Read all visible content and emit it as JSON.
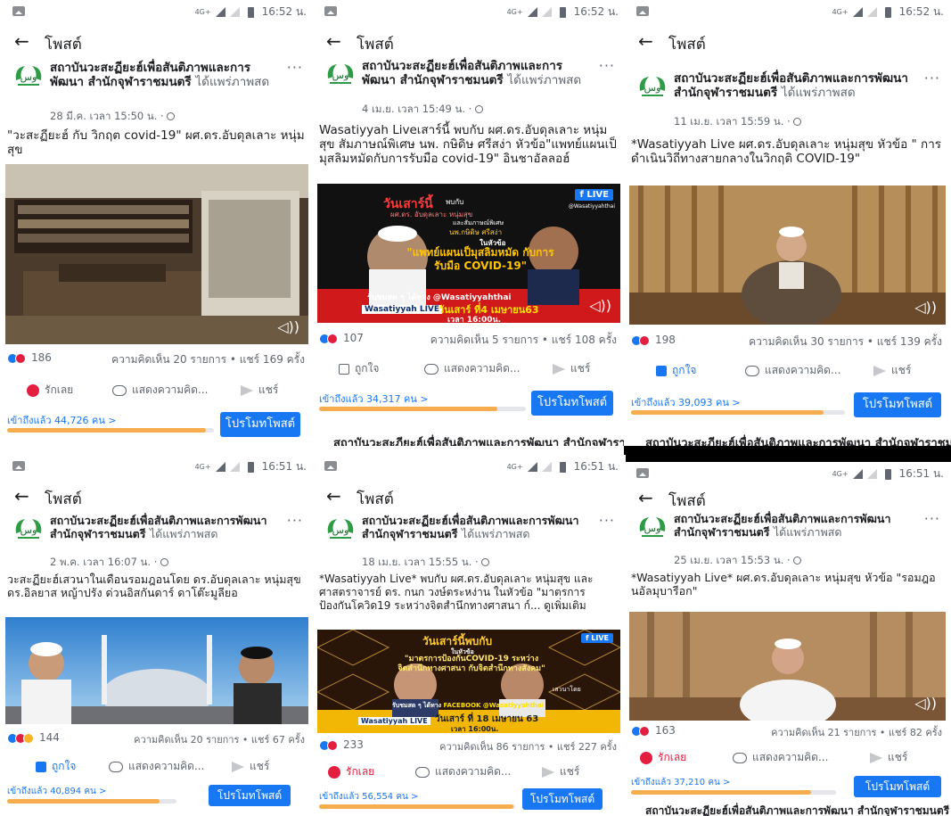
{
  "common": {
    "back_glyph": "←",
    "header_title": "โพสต์",
    "network": "4G+",
    "page_name": "สถาบันวะสะฏียะฮ์เพื่อสันติภาพและการพัฒนา สำนักจุฬาราชมนตรี",
    "shared_suffix": "ได้แพร่ภาพสด",
    "more_glyph": "···",
    "comment_label": "แสดงความคิด...",
    "share_label": "แชร์",
    "promote_label": "โปรโมทโพสต์",
    "love_label": "รักเลย",
    "like_label": "ถูกใจ"
  },
  "posts": [
    {
      "time": "16:52 น.",
      "date": "28 มี.ค. เวลา 15:50 น. · ",
      "text": "\"วะสะฏียะฮ์ กับ วิกฤต covid-19\" ผศ.ดร.อับดุลเลาะ หนุ่มสุข",
      "reactions": "186",
      "stats": "ความคิดเห็น 20 รายการ • แชร์ 169 ครั้ง",
      "action1": "รักเลย",
      "reach": "เข้าถึงแล้ว 44,726 คน >",
      "reach_fraction": 0.96
    },
    {
      "time": "16:52 น.",
      "date": "4 เม.ย. เวลา 15:49 น. · ",
      "text": "Wasatiyyah Liveเสาร์นี้ พบกับ ผศ.ดร.อับดุลเลาะ หนุ่มสุข สัมภาษณ์พิเศษ นพ. กษิดิษ ศรีสง่า หัวข้อ\"แพทย์แผนเป็มุสลิมหมัดกับการรับมือ covid-19\" อินชาอัลลอฮ์",
      "reactions": "107",
      "stats": "ความคิดเห็น 5 รายการ • แชร์ 108 ครั้ง",
      "action1": "ถูกใจ",
      "reach": "เข้าถึงแล้ว 34,317 คน >",
      "reach_fraction": 0.86,
      "poster": {
        "headline": "วันเสาร์นี้",
        "with": "พบกับ",
        "host": "ผศ.ดร. อับดุลเลาะ หนุ่มสุข",
        "and": "และสัมภาษณ์พิเศษ",
        "guest": "นพ.กษิดิษ ศรีสง่า",
        "topic_label": "ในหัวข้อ",
        "topic": "\"แพทย์แผนเป็มุสลิมหมัด กับการรับมือ COVID-19\"",
        "live_badge": "LIVE",
        "fb_handle": "@Wasatiyyahthai",
        "strip": "รับชมสด ๆ ได้ทาง",
        "strip_handle": "@Wasatiyyahthai",
        "live_logo": "Wasatiyyah LIVE",
        "when": "วันเสาร์ ที่4 เมษายน63",
        "clock": "เวลา 16:00น."
      }
    },
    {
      "time": "16:52 น.",
      "date": "11 เม.ย. เวลา 15:59 น. · ",
      "text": "*Wasatiyyah Live ผศ.ดร.อับดุลเลาะ หนุ่มสุข หัวข้อ \" การดำเนินวิถีทางสายกลางในวิกฤติ COVID-19\"",
      "reactions": "198",
      "stats": "ความคิดเห็น 30 รายการ • แชร์ 139 ครั้ง",
      "action1": "ถูกใจ",
      "reach": "เข้าถึงแล้ว 39,093 คน >",
      "reach_fraction": 0.9
    },
    {
      "time": "16:51 น.",
      "date": "2 พ.ค. เวลา 16:07 น. · ",
      "text": "วะสะฏียะฮ์เสวนาในเดือนรอมฎอนโดย ดร.อับดุลเลาะ หนุ่มสุข ดร.อิลยาส หญ้าปรัง ด่วนอิสกันดาร์ ดาโต๊ะมูลียอ",
      "reactions": "144",
      "stats": "ความคิดเห็น 20 รายการ • แชร์ 67 ครั้ง",
      "action1": "ถูกใจ",
      "reach": "เข้าถึงแล้ว 40,894 คน >",
      "reach_fraction": 0.9
    },
    {
      "time": "16:51 น.",
      "date": "18 เม.ย. เวลา 15:55 น. · ",
      "text": "*Wasatiyyah Live* พบกับ ผศ.ดร.อับดุลเลาะ หนุ่มสุข และ ศาสตราจารย์ ดร. กนก วงษ์ตระหง่าน ในหัวข้อ \"มาตรการป้องกันโควิด19 ระหว่างจิตสำนึกทางศาสนา ก์... ดูเพิ่มเติม",
      "reactions": "233",
      "stats": "ความคิดเห็น 86 รายการ • แชร์ 227 ครั้ง",
      "action1": "รักเลย",
      "reach": "เข้าถึงแล้ว 56,554 คน >",
      "reach_fraction": 0.99,
      "poster": {
        "headline": "วันเสาร์นี้พบกับ",
        "topic_label": "ในหัวข้อ",
        "topic": "\"มาตรการป้องกันCOVID-19 ระหว่างจิตสำนึกทางศาสนา กับจิตสำนึกทางสังคม\"",
        "live_badge": "LIVE",
        "presenter": "เสวนาโดย",
        "strip": "รับชมสด ๆ ได้ทาง",
        "strip_handle": "FACEBOOK @Wasatiyyahthai",
        "live_logo": "Wasatiyyah LIVE",
        "when": "วันเสาร์ ที่ 18 เมษายน 63",
        "clock": "เวลา 16:00น."
      }
    },
    {
      "time": "16:51 น.",
      "date": "25 เม.ย. เวลา 15:53 น. · ",
      "text": "*Wasatiyyah Live* ผศ.ดร.อับดุลเลาะ หนุ่มสุข หัวข้อ \"รอมฎอนอัลมุบารีอก\"",
      "reactions": "163",
      "stats": "ความคิดเห็น 21 รายการ • แชร์ 82 ครั้ง",
      "action1": "รักเลย",
      "reach": "เข้าถึงแล้ว 37,210 คน >",
      "reach_fraction": 0.88
    }
  ]
}
